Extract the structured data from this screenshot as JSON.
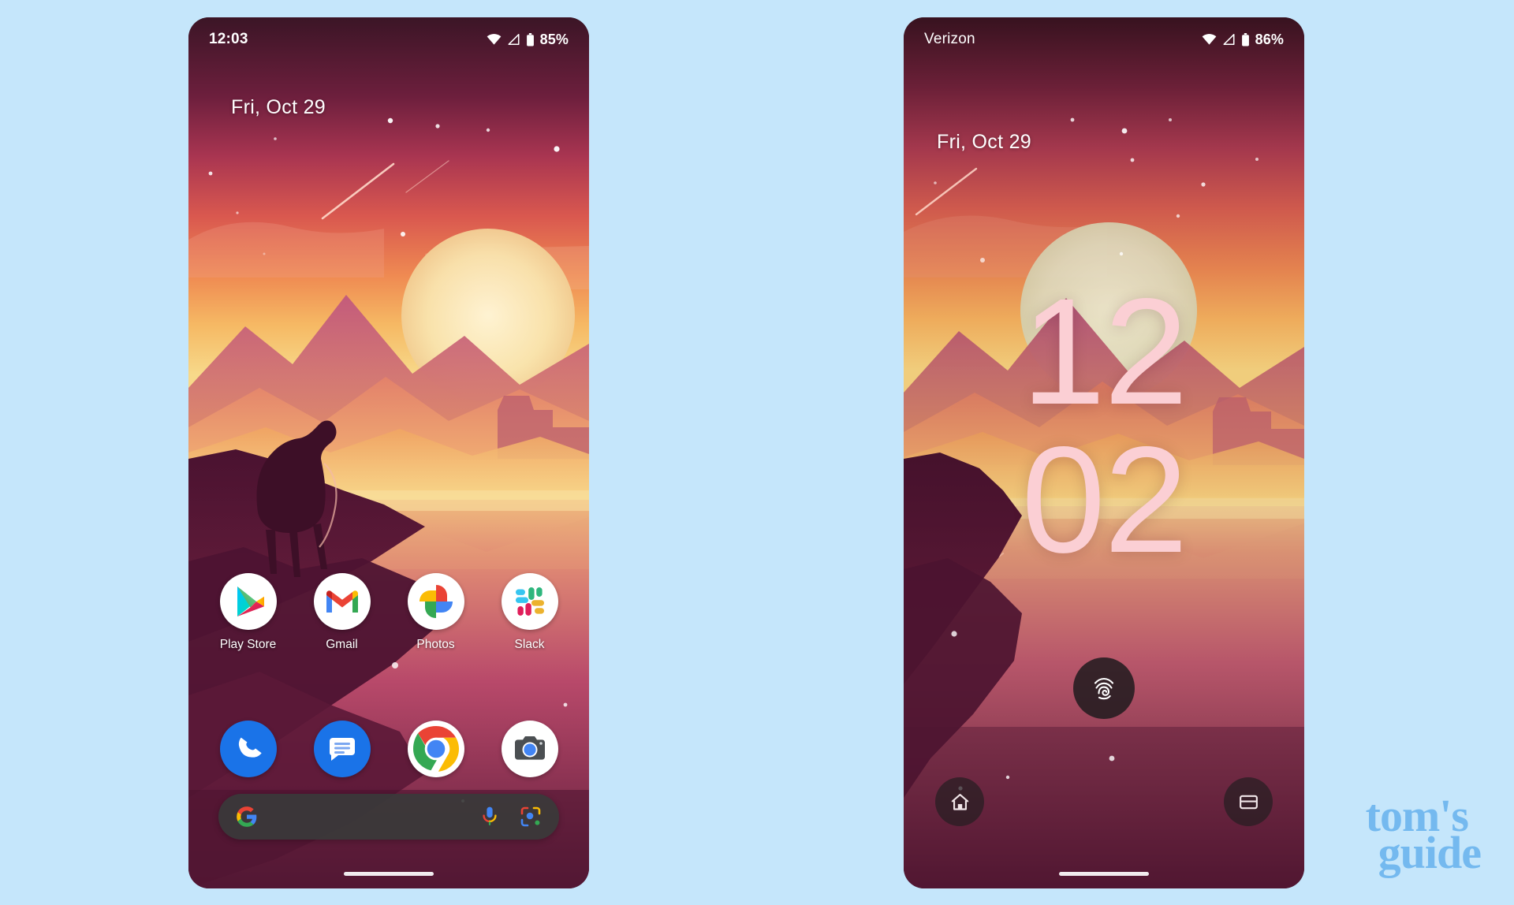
{
  "page": {
    "background_color": "#c5e6fb",
    "watermark": {
      "line1": "tom's",
      "line2": "guide",
      "color": "#74b9ef"
    }
  },
  "phones": [
    {
      "id": "home-screen",
      "name": "pixel-home-screen",
      "status_bar": {
        "left_text": "12:03",
        "battery_percent": "85%",
        "icons": [
          "wifi-icon",
          "signal-icon",
          "battery-icon"
        ]
      },
      "date_widget": "Fri, Oct 29",
      "app_rows": [
        {
          "row": "main",
          "apps": [
            {
              "label": "Play Store",
              "icon": "play-store-icon"
            },
            {
              "label": "Gmail",
              "icon": "gmail-icon"
            },
            {
              "label": "Photos",
              "icon": "google-photos-icon"
            },
            {
              "label": "Slack",
              "icon": "slack-icon"
            }
          ]
        },
        {
          "row": "dock",
          "apps": [
            {
              "label": "Phone",
              "icon": "phone-icon"
            },
            {
              "label": "Messages",
              "icon": "messages-icon"
            },
            {
              "label": "Chrome",
              "icon": "chrome-icon"
            },
            {
              "label": "Camera",
              "icon": "camera-icon"
            }
          ]
        }
      ],
      "search_bar": {
        "value": "",
        "placeholder": "",
        "left_icon": "google-g-icon",
        "right_icons": [
          "microphone-icon",
          "google-lens-icon"
        ]
      }
    },
    {
      "id": "lock-screen",
      "name": "pixel-lock-screen",
      "status_bar": {
        "left_text": "Verizon",
        "battery_percent": "86%",
        "icons": [
          "wifi-icon",
          "signal-icon",
          "battery-icon"
        ]
      },
      "date_widget": "Fri, Oct 29",
      "clock": {
        "hours": "12",
        "minutes": "02",
        "color": "#fbcfd4"
      },
      "fingerprint_hint": "fingerprint-icon",
      "shortcuts": [
        {
          "position": "left",
          "icon": "home-controls-icon"
        },
        {
          "position": "right",
          "icon": "wallet-icon"
        }
      ]
    }
  ]
}
